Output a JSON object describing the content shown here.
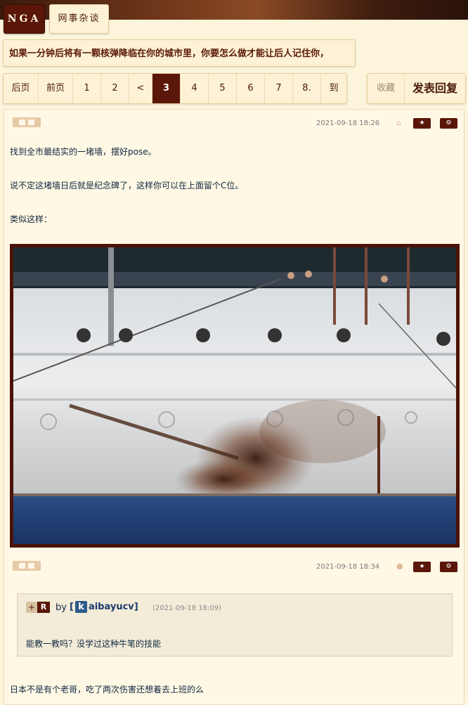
{
  "header": {
    "logo": "NGA",
    "forum_name": "网事杂谈"
  },
  "thread": {
    "title": "如果一分钟后将有一颗核弹降临在你的城市里，你要怎么做才能让后人记住你，"
  },
  "pagination": {
    "items": [
      "后页",
      "前页",
      "1",
      "2",
      "<",
      "3",
      "4",
      "5",
      "6",
      "7",
      "8.",
      "到"
    ],
    "current": "3"
  },
  "actions": {
    "favorite": "收藏",
    "reply": "发表回复"
  },
  "post": {
    "time_top": "2021-09-18 18:26",
    "time_bottom": "2021-09-18 18:34",
    "device_top": "android-icon",
    "device_bottom": "apple-icon",
    "paragraphs": [
      "找到全市最结实的一堵墙，摆好pose。",
      "说不定这堵墙日后就是纪念碑了，这样你可以在上面留个C位。",
      "类似这样："
    ],
    "quote": {
      "plus": "+",
      "r": "R",
      "by": "by",
      "user_badge": "k",
      "username": "aibayucv",
      "time": "(2021-09-18 18:09)",
      "text": "能教一教吗？没学过这种牛笔的技能"
    },
    "reply_text": "日本不是有个老哥，吃了两次伤害还想着去上班的么"
  },
  "colors": {
    "brand": "#5a1608",
    "background": "#fdf4dc"
  }
}
